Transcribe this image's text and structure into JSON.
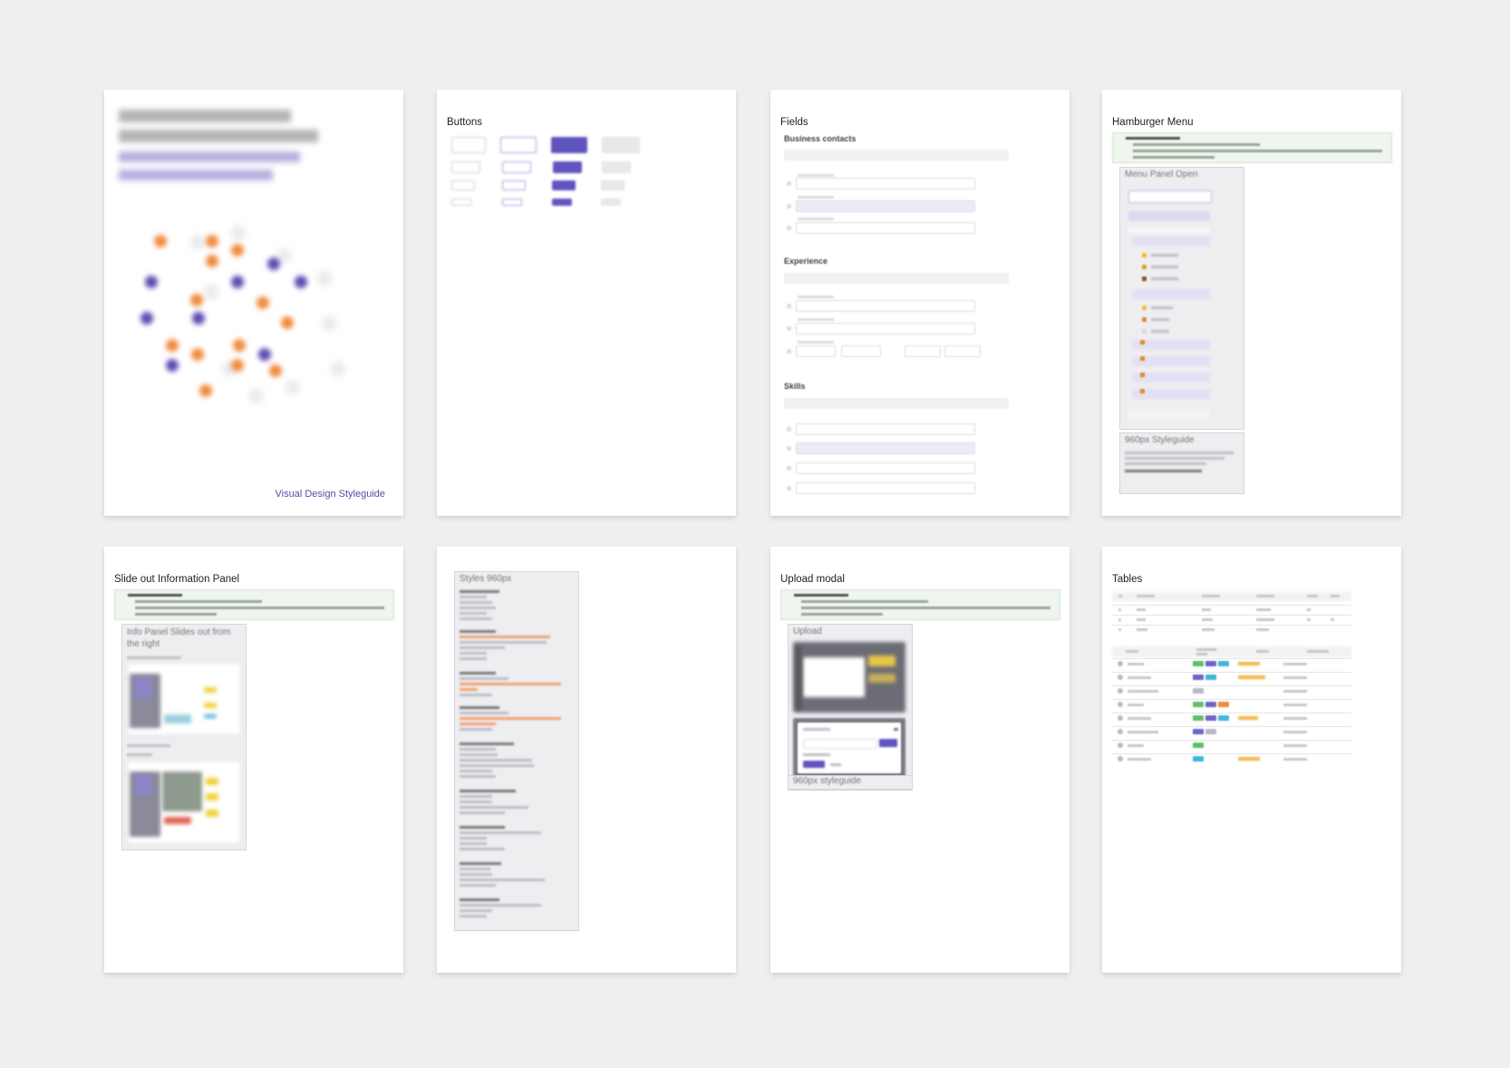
{
  "pages": {
    "cover": {
      "footer": "Visual Design Styleguide"
    },
    "buttons": {
      "title": "Buttons"
    },
    "fields": {
      "title": "Fields",
      "sections": [
        "Business contacts",
        "Experience",
        "Skills"
      ]
    },
    "hamburger": {
      "title": "Hamburger Menu",
      "panel_title": "Menu Panel Open",
      "styleguide_title": "960px Styleguide"
    },
    "slideout": {
      "title": "Slide out Information Panel",
      "panel_title": "Info Panel Slides out from the right"
    },
    "styles": {
      "title": "Styles 960px"
    },
    "upload": {
      "title": "Upload modal",
      "panel_title": "Upload",
      "footer_title": "960px styleguide"
    },
    "tables": {
      "title": "Tables"
    }
  },
  "colors": {
    "background": "#efefef",
    "accent": "#5f54c0",
    "orange": "#f08a3c",
    "note_green": "#eef6ee"
  }
}
